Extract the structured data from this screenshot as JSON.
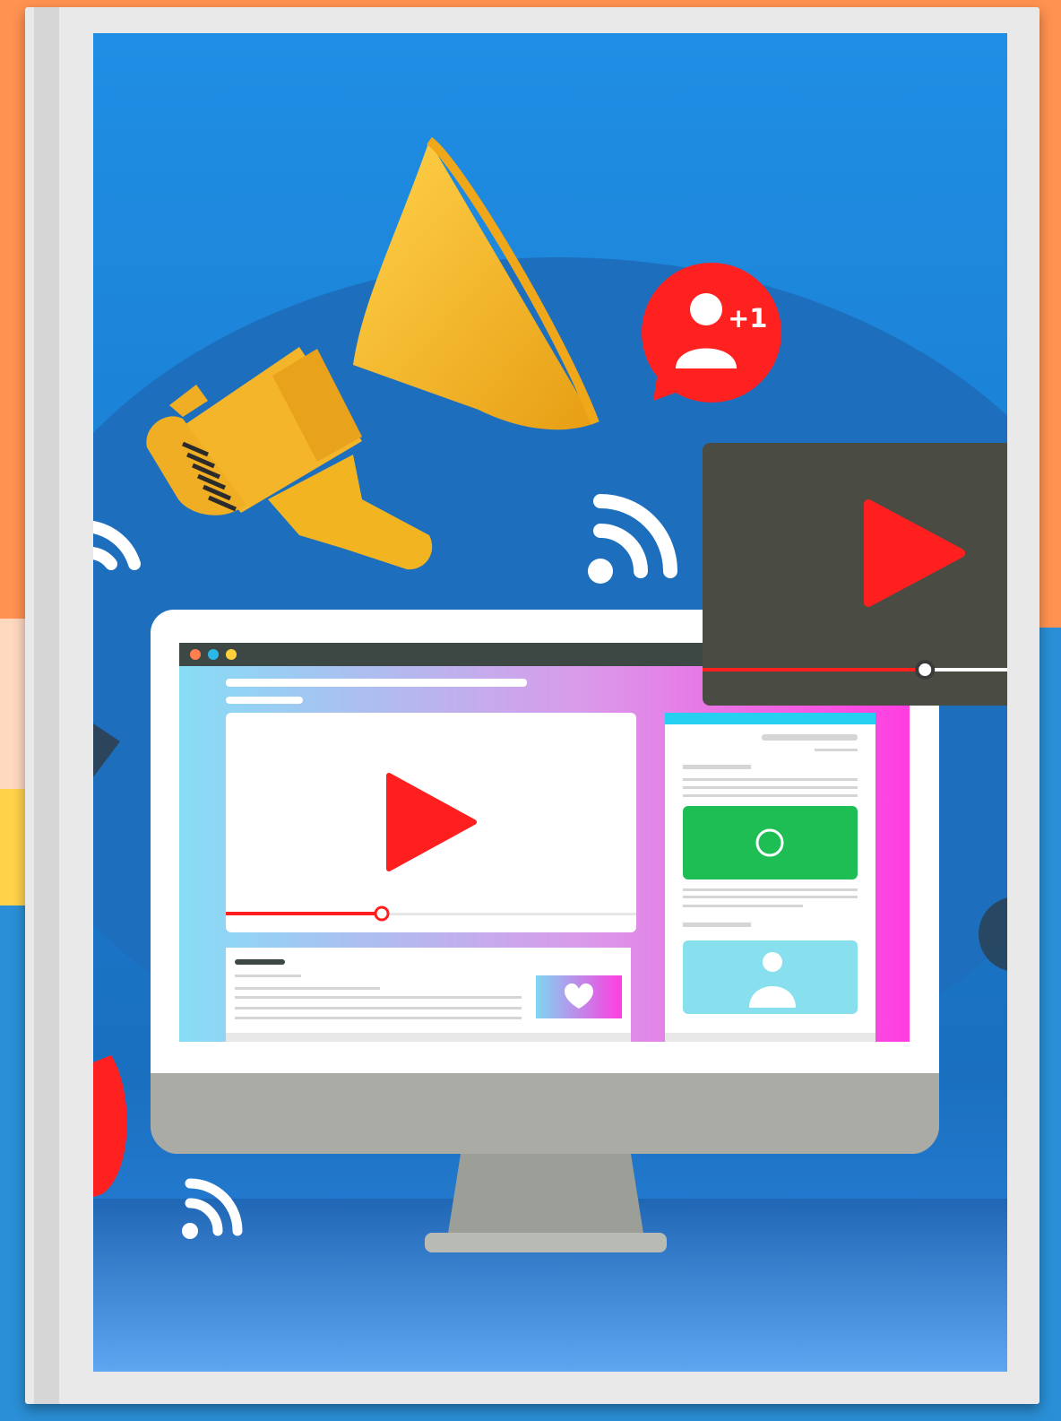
{
  "badge": {
    "label": "+1"
  },
  "colors": {
    "cover_blue": "#1f8ee4",
    "arch_blue": "#1d6fbd",
    "megaphone_yellow": "#f5b82a",
    "play_red": "#ff1f1f",
    "browser_bar": "#3d4744",
    "green_button": "#1ebe55",
    "monitor_gray": "#a9aba4"
  },
  "icons": [
    "megaphone-icon",
    "add-user-icon",
    "rss-icon",
    "play-icon",
    "heart-icon",
    "user-icon",
    "circle-icon",
    "gear-icon"
  ],
  "progress": {
    "main_video": 0.38,
    "floating_video": 0.73
  }
}
